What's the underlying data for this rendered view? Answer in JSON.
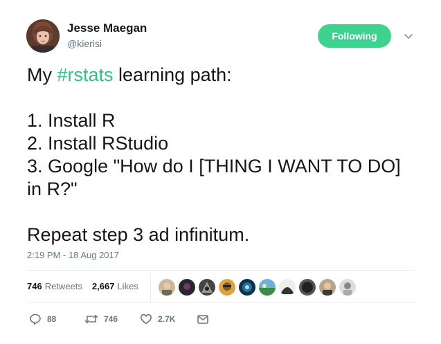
{
  "author": {
    "name": "Jesse Maegan",
    "handle": "@kierisi"
  },
  "follow_button": {
    "label": "Following"
  },
  "tweet": {
    "lines": {
      "l1_prefix": "My ",
      "l1_hashtag": "#rstats",
      "l1_suffix": " learning path:",
      "l2": "1. Install R",
      "l3": "2. Install RStudio",
      "l4": "3. Google \"How do I [THING I WANT TO DO]",
      "l5": "in R?\"",
      "l6": "Repeat step 3 ad infinitum."
    },
    "timestamp": "2:19 PM - 18 Aug 2017"
  },
  "stats": {
    "retweets_count": "746",
    "retweets_label": "Retweets",
    "likes_count": "2,667",
    "likes_label": "Likes"
  },
  "actions": {
    "reply_count": "88",
    "retweet_count": "746",
    "like_count": "2.7K"
  },
  "colors": {
    "accent": "#3fd28f",
    "hashtag": "#2fc284",
    "secondary_text": "#657786",
    "primary_text": "#14171a",
    "divider": "#e6ecf0"
  },
  "icons": {
    "reply": "reply-icon",
    "retweet": "retweet-icon",
    "like": "heart-icon",
    "dm": "envelope-icon",
    "menu": "chevron-down-icon"
  }
}
